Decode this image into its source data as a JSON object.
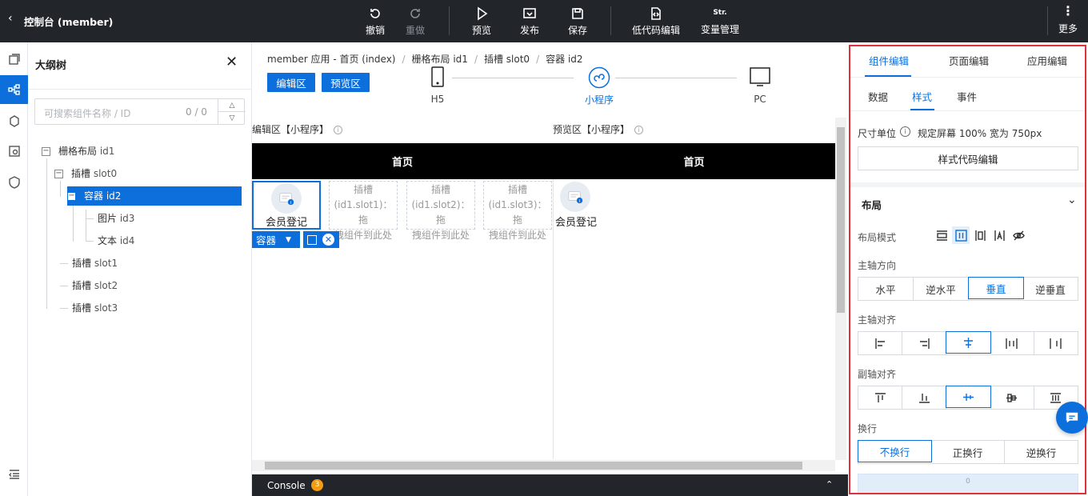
{
  "topbar": {
    "back_icon": "chevron-left",
    "title": "控制台 (member)",
    "undo": "撤销",
    "redo": "重做",
    "preview": "预览",
    "publish": "发布",
    "save": "保存",
    "lowcode": "低代码编辑",
    "var_icon": "Str.",
    "vars": "变量管理",
    "more": "更多"
  },
  "outline": {
    "title": "大纲树",
    "search_placeholder": "可搜索组件名称 / ID",
    "count": "0 / 0",
    "tree": [
      {
        "name": "栅格布局",
        "id": "id1"
      },
      {
        "name": "插槽",
        "id": "slot0"
      },
      {
        "name": "容器",
        "id": "id2"
      },
      {
        "name": "图片",
        "id": "id3"
      },
      {
        "name": "文本",
        "id": "id4"
      },
      {
        "name": "插槽",
        "id": "slot1"
      },
      {
        "name": "插槽",
        "id": "slot2"
      },
      {
        "name": "插槽",
        "id": "slot3"
      }
    ]
  },
  "center": {
    "breadcrumb": [
      "member 应用 - 首页 (index)",
      "栅格布局 id1",
      "插槽 slot0",
      "容器 id2"
    ],
    "edit_btn": "编辑区",
    "preview_btn": "预览区",
    "devices": {
      "h5": "H5",
      "mini": "小程序",
      "pc": "PC"
    },
    "edit_header": "编辑区【小程序】",
    "preview_header": "预览区【小程序】",
    "page_title": "首页",
    "member_label": "会员登记",
    "slots": [
      [
        "插槽",
        "(id1.slot1)：拖",
        "拽组件到此处"
      ],
      [
        "插槽",
        "(id1.slot2)：拖",
        "拽组件到此处"
      ],
      [
        "插槽",
        "(id1.slot3)：拖",
        "拽组件到此处"
      ]
    ],
    "container_tag": "容器",
    "console": "Console",
    "console_count": "3"
  },
  "right": {
    "tabs": [
      "组件编辑",
      "页面编辑",
      "应用编辑"
    ],
    "subtabs": [
      "数据",
      "样式",
      "事件"
    ],
    "unit_label": "尺寸单位",
    "unit_value": "规定屏幕 100% 宽为 750px",
    "style_code_btn": "样式代码编辑",
    "layout_title": "布局",
    "layout_mode_label": "布局模式",
    "main_axis_label": "主轴方向",
    "main_axis_options": [
      "水平",
      "逆水平",
      "垂直",
      "逆垂直"
    ],
    "main_align_label": "主轴对齐",
    "cross_align_label": "副轴对齐",
    "wrap_label": "换行",
    "wrap_options": [
      "不换行",
      "正换行",
      "逆换行"
    ],
    "spacing_value": "0"
  },
  "colors": {
    "accent": "#0d6fdb",
    "highlight_border": "#e0303a",
    "topbar": "#22262b",
    "badge": "#f39c12"
  }
}
